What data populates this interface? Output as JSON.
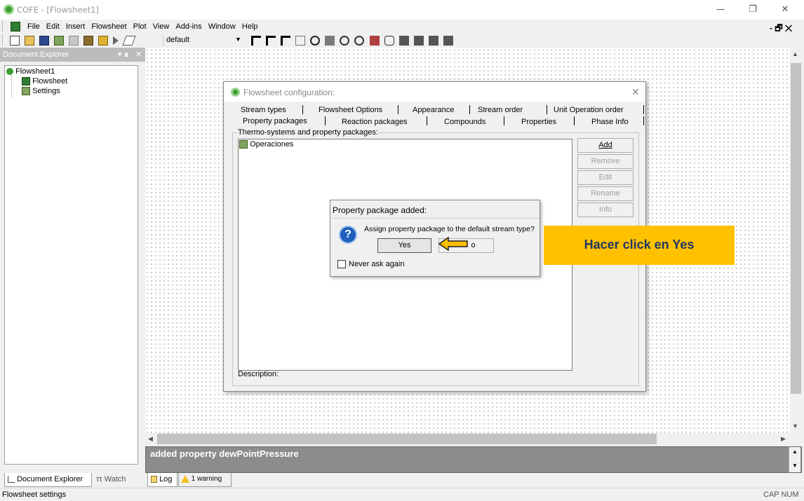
{
  "app": {
    "title": "COFE - [Flowsheet1]"
  },
  "menu": [
    "File",
    "Edit",
    "Insert",
    "Flowsheet",
    "Plot",
    "View",
    "Add-ins",
    "Window",
    "Help"
  ],
  "toolbar": {
    "combo_value": "default"
  },
  "doc_explorer": {
    "title": "Document Explorer",
    "tree": {
      "root": "Flowsheet1",
      "children": [
        "Flowsheet",
        "Settings"
      ]
    }
  },
  "dialog": {
    "title": "Flowsheet configuration:",
    "tabs_row1": [
      "Stream types",
      "Flowsheet Options",
      "Appearance",
      "Stream order",
      "Unit Operation order"
    ],
    "tabs_row2": [
      "Property packages",
      "Reaction packages",
      "Compounds",
      "Properties",
      "Phase Info"
    ],
    "active_tab": "Property packages",
    "group_label": "Thermo-systems and property packages:",
    "list_items": [
      "Operaciones"
    ],
    "buttons": {
      "add": "Add",
      "remove": "Remove",
      "edit": "Edit",
      "rename": "Rename",
      "info": "Info"
    },
    "description_label": "Description:"
  },
  "message_box": {
    "title": "Property package added:",
    "text": "Assign property package to the default stream type?",
    "yes": "Yes",
    "no_visible": "o",
    "checkbox": "Never ask again"
  },
  "callout": {
    "text": "Hacer click en Yes"
  },
  "log": {
    "text": "added property dewPointPressure"
  },
  "bottom_tabs": {
    "document_explorer": "Document Explorer",
    "watch": "Watch",
    "log": "Log",
    "warning": "1 warning"
  },
  "status": {
    "left": "Flowsheet settings",
    "right": "CAP NUM"
  },
  "colors": {
    "callout_bg": "#ffc000",
    "callout_text": "#1f3864",
    "arrow": "#ffc000",
    "log_bg": "#8c8c8c"
  }
}
